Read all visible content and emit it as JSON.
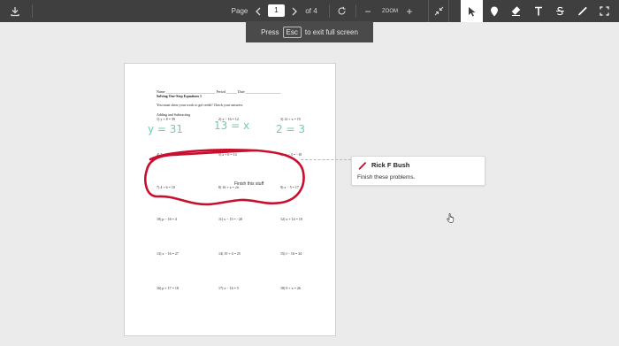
{
  "toolbar": {
    "page_label": "Page",
    "page_value": "1",
    "of_pages": "of 4",
    "zoom_label": "ZOOM",
    "zoom_out": "−",
    "zoom_in": "+",
    "prev_icon": "chevron-left-icon",
    "next_icon": "chevron-right-icon",
    "rotate_icon": "rotate-icon",
    "download_icon": "download-icon",
    "fullscreen_exit_icon": "exit-fullscreen-icon"
  },
  "tools": [
    {
      "name": "select",
      "icon": "pointer-icon"
    },
    {
      "name": "comment",
      "icon": "map-pin-icon"
    },
    {
      "name": "highlight",
      "icon": "highlighter-icon"
    },
    {
      "name": "text",
      "icon": "text-icon"
    },
    {
      "name": "strikeout",
      "icon": "strikethrough-icon"
    },
    {
      "name": "draw",
      "icon": "pen-icon"
    },
    {
      "name": "area",
      "icon": "crop-frame-icon"
    }
  ],
  "toast": {
    "prefix": "Press",
    "key": "Esc",
    "suffix": "to exit full screen"
  },
  "document": {
    "header_line": "Name ____________________________ Period ______ Date ____________________",
    "worksheet_title": "Solving One-Step Equations 1",
    "instructions": "You must show your work to get credit! Check your answers.",
    "section_title": "Adding and Subtracting",
    "problems": [
      "1) y + 8 = 39",
      "2) x − 16 = 12",
      "3) 12 + x = 15",
      "4) 7 + x = 15",
      "5) a + 6 = 14",
      "6) m − 3 = −10",
      "7) 4 + b = 10",
      "8) 16 + x = 28",
      "9) x − 5 = 17",
      "10) p − 16 = 4",
      "11) x − 15 = −20",
      "12) x + 14 = 10",
      "13) x − 16 = 27",
      "14) 19 + 4 = 25",
      "15) f − 16 = 34",
      "16) p + 17 = 18",
      "17) x − 16 = 5",
      "18) 9 + x = 26"
    ],
    "handwriting": [
      "y = 31",
      "13 = x",
      "2 = 3"
    ],
    "scribble_label": "Finish this stuff"
  },
  "comment": {
    "author": "Rick F Bush",
    "text": "Finish these problems.",
    "color": "#c8102e"
  },
  "colors": {
    "toolbar": "#3f3f3f",
    "background": "#ebebeb",
    "annotation": "#c8102e",
    "handwriting": "#69d0b0"
  }
}
